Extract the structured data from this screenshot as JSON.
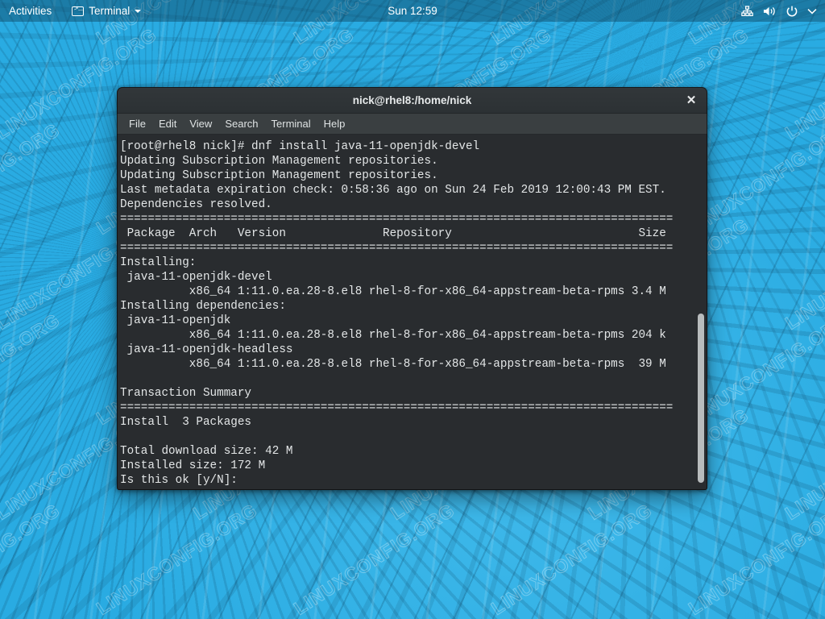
{
  "topbar": {
    "activities_label": "Activities",
    "app_name": "Terminal",
    "app_icon": "terminal-icon",
    "clock": "Sun 12:59",
    "status_icons": [
      "network-icon",
      "volume-icon",
      "power-icon",
      "chevron-down-icon"
    ]
  },
  "window": {
    "title": "nick@rhel8:/home/nick",
    "close_label": "✕",
    "menu": [
      "File",
      "Edit",
      "View",
      "Search",
      "Terminal",
      "Help"
    ]
  },
  "terminal": {
    "lines": [
      "[root@rhel8 nick]# dnf install java-11-openjdk-devel",
      "Updating Subscription Management repositories.",
      "Updating Subscription Management repositories.",
      "Last metadata expiration check: 0:58:36 ago on Sun 24 Feb 2019 12:00:43 PM EST.",
      "Dependencies resolved.",
      "================================================================================",
      " Package  Arch   Version              Repository                           Size",
      "================================================================================",
      "Installing:",
      " java-11-openjdk-devel",
      "          x86_64 1:11.0.ea.28-8.el8 rhel-8-for-x86_64-appstream-beta-rpms 3.4 M",
      "Installing dependencies:",
      " java-11-openjdk",
      "          x86_64 1:11.0.ea.28-8.el8 rhel-8-for-x86_64-appstream-beta-rpms 204 k",
      " java-11-openjdk-headless",
      "          x86_64 1:11.0.ea.28-8.el8 rhel-8-for-x86_64-appstream-beta-rpms  39 M",
      "",
      "Transaction Summary",
      "================================================================================",
      "Install  3 Packages",
      "",
      "Total download size: 42 M",
      "Installed size: 172 M",
      "Is this ok [y/N]:"
    ]
  },
  "desktop": {
    "watermark_text": "LINUXCONFIG.ORG",
    "wallpaper_color": "#29abe2"
  },
  "colors": {
    "desktop_blue": "#29abe2",
    "topbar": "#1a7fa5",
    "terminal_bg": "#292c2f",
    "menubar_bg": "#3a3f41",
    "titlebar_bg": "#32373a",
    "terminal_fg": "#e3e6e7",
    "scrollbar_thumb": "#b8bcbd"
  }
}
